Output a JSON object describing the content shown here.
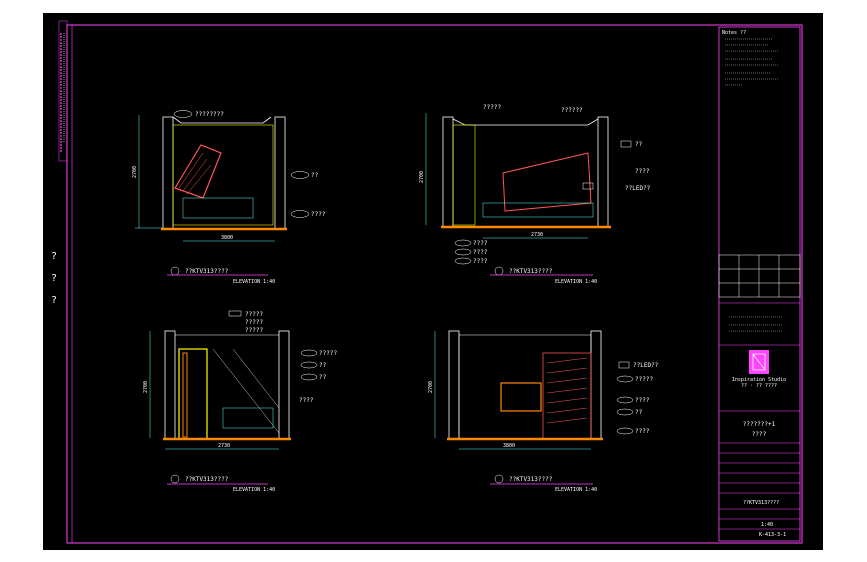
{
  "drawing": {
    "left_margin_labels": [
      "?",
      "?",
      "?"
    ],
    "views": [
      {
        "title": "??KTV313????",
        "scale": "ELEVATION 1:40",
        "dim_height": "2700",
        "dim_width": "3800",
        "callouts": [
          "????????",
          "??",
          "????"
        ]
      },
      {
        "title": "??KTV313????",
        "scale": "ELEVATION 1:40",
        "dim_height": "2700",
        "dim_width": "2730",
        "callouts": [
          "?????",
          "??????",
          "??",
          "????",
          "??LED??",
          "????",
          "????",
          "????"
        ]
      },
      {
        "title": "??KTV313????",
        "scale": "ELEVATION 1:40",
        "dim_height": "2700",
        "dim_width": "2730",
        "callouts": [
          "?????",
          "?????",
          "?????",
          "?????",
          "??",
          "??",
          "????"
        ]
      },
      {
        "title": "??KTV313????",
        "scale": "ELEVATION 1:40",
        "dim_height": "2700",
        "dim_width": "3800",
        "callouts": [
          "??LED??",
          "?????",
          "????",
          "??",
          "????"
        ]
      }
    ]
  },
  "title_block": {
    "notes_header": "Notes ??",
    "company": "Inspiration Studio",
    "company_sub": "??  ·  ??  ????",
    "project": "???????+1",
    "project_sub": "????",
    "drawing_name": "??KTV313????",
    "scale_value": "1:40",
    "sheet_no": "K-413-3-1"
  }
}
